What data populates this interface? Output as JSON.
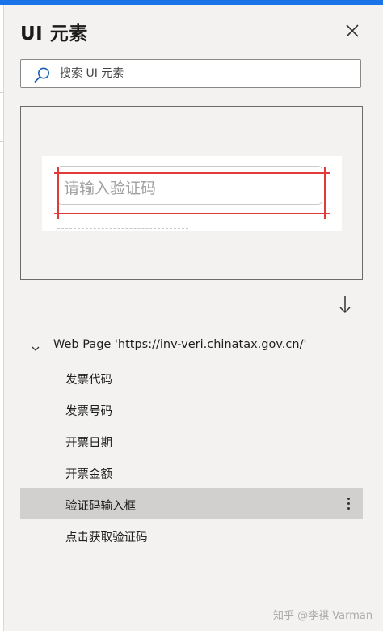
{
  "panel": {
    "title": "UI 元素"
  },
  "search": {
    "placeholder": "搜索 UI 元素"
  },
  "preview": {
    "field_placeholder": "请输入验证码"
  },
  "tree": {
    "root_label": "Web Page 'https://inv-veri.chinatax.gov.cn/'",
    "items": [
      {
        "label": "发票代码"
      },
      {
        "label": "发票号码"
      },
      {
        "label": "开票日期"
      },
      {
        "label": "开票金额"
      },
      {
        "label": "验证码输入框",
        "selected": true
      },
      {
        "label": "点击获取验证码"
      }
    ]
  },
  "watermark": "知乎 @李祺 Varman",
  "colors": {
    "accent": "#1a73e8",
    "highlight": "#e03a3a",
    "selected_row": "#d2d0ce",
    "panel_bg": "#f3f2f1"
  }
}
